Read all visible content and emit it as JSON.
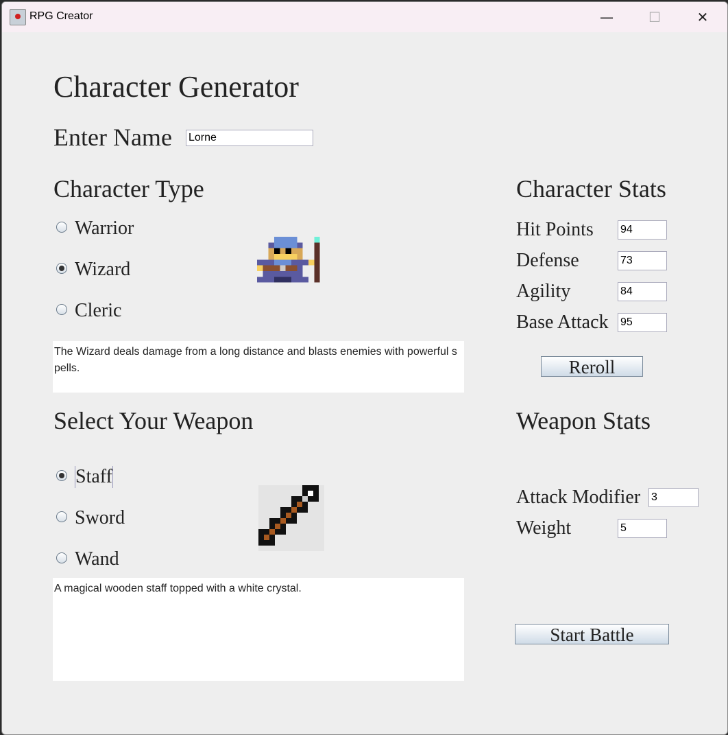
{
  "window": {
    "title": "RPG Creator",
    "minimize": "—",
    "maximize": "☐",
    "close": "✕"
  },
  "heading": "Character Generator",
  "name": {
    "label": "Enter Name",
    "value": "Lorne"
  },
  "character_type": {
    "heading": "Character Type",
    "options": [
      "Warrior",
      "Wizard",
      "Cleric"
    ],
    "selected": "Wizard",
    "description": "The Wizard deals damage from a long distance and blasts enemies with powerful spells."
  },
  "character_stats": {
    "heading": "Character Stats",
    "stats": [
      {
        "label": "Hit Points",
        "value": "94"
      },
      {
        "label": "Defense",
        "value": "73"
      },
      {
        "label": "Agility",
        "value": "84"
      },
      {
        "label": "Base Attack",
        "value": "95"
      }
    ],
    "reroll": "Reroll"
  },
  "weapon": {
    "heading": "Select Your Weapon",
    "options": [
      "Staff",
      "Sword",
      "Wand"
    ],
    "selected": "Staff",
    "description": "A magical wooden staff topped with a white crystal."
  },
  "weapon_stats": {
    "heading": "Weapon Stats",
    "stats": [
      {
        "label": "Attack Modifier",
        "value": "3"
      },
      {
        "label": "Weight",
        "value": "5"
      }
    ]
  },
  "start_battle": "Start Battle"
}
